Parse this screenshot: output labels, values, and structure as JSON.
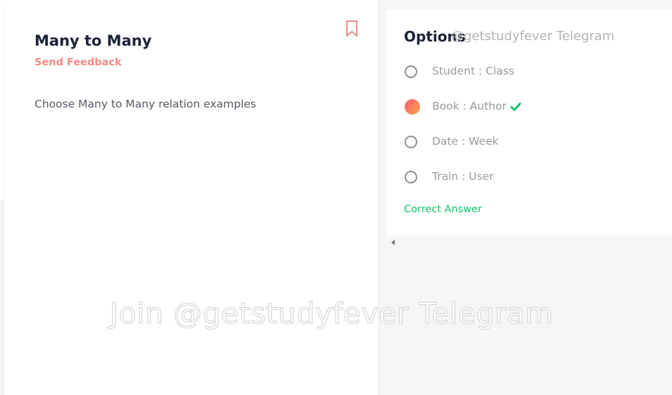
{
  "question": {
    "title": "Many to Many",
    "feedback_label": "Send Feedback",
    "text": "Choose Many to Many relation examples",
    "bookmark_icon": "bookmark-icon"
  },
  "options_panel": {
    "title": "Options",
    "watermark": "@getstudyfever Telegram",
    "options": [
      {
        "label": "Student : Class",
        "selected": false
      },
      {
        "label": "Book : Author",
        "selected": true,
        "correct": true
      },
      {
        "label": "Date : Week",
        "selected": false
      },
      {
        "label": "Train : User",
        "selected": false
      }
    ],
    "correct_label": "Correct Answer"
  },
  "watermark": "Join @getstudyfever Telegram",
  "colors": {
    "accent": "#f28a87",
    "correct": "#11c36a",
    "selected_gradient_start": "#fb5c72",
    "selected_gradient_end": "#fba347",
    "title": "#1b2238"
  }
}
